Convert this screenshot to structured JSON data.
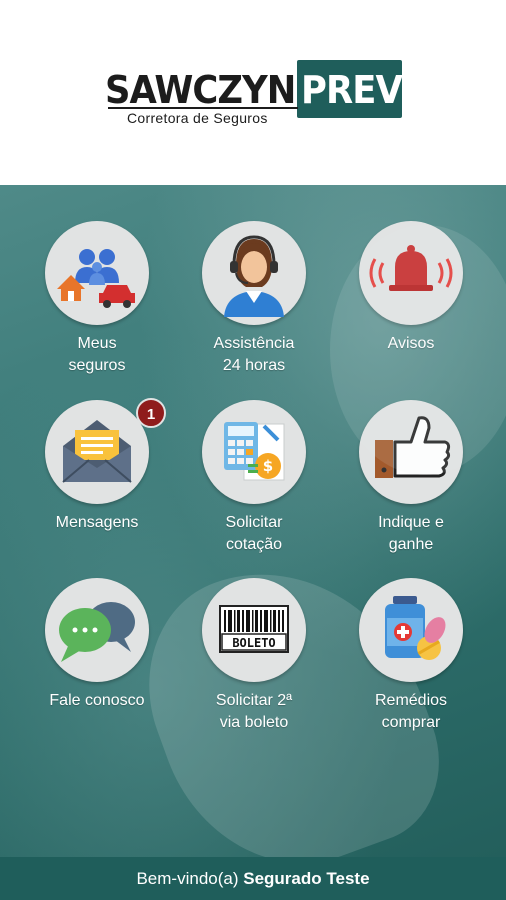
{
  "header": {
    "logo_main": "SAWCZYN",
    "logo_accent": "PREV",
    "logo_sub": "Corretora de Seguros"
  },
  "colors": {
    "brand_teal": "#1f5e5b",
    "badge_red": "#8f1c1c",
    "tile_circle": "#e1e3e3"
  },
  "tiles": [
    {
      "label_1": "Meus",
      "label_2": "seguros",
      "icon": "family-home-car-icon"
    },
    {
      "label_1": "Assistência",
      "label_2": "24 horas",
      "icon": "headset-agent-icon"
    },
    {
      "label_1": "Avisos",
      "label_2": "",
      "icon": "alarm-bell-icon"
    },
    {
      "label_1": "Mensagens",
      "label_2": "",
      "icon": "envelope-icon",
      "badge": "1"
    },
    {
      "label_1": "Solicitar",
      "label_2": "cotação",
      "icon": "calculator-document-icon"
    },
    {
      "label_1": "Indique e",
      "label_2": "ganhe",
      "icon": "thumbs-up-icon"
    },
    {
      "label_1": "Fale conosco",
      "label_2": "",
      "icon": "chat-bubbles-icon"
    },
    {
      "label_1": "Solicitar 2ª",
      "label_2": "via boleto",
      "icon": "barcode-boleto-icon",
      "icon_text": "BOLETO"
    },
    {
      "label_1": "Remédios",
      "label_2": "comprar",
      "icon": "medicine-pills-icon"
    }
  ],
  "footer": {
    "greeting": "Bem-vindo(a)",
    "user_name": "Segurado Teste"
  }
}
